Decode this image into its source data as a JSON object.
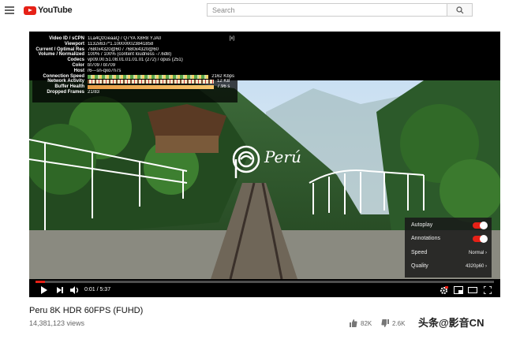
{
  "header": {
    "logo_text": "YouTube",
    "search_placeholder": "Search"
  },
  "stats": {
    "close_label": "[x]",
    "rows": [
      {
        "key": "Video ID / sCPN",
        "value": "1La4QzGeaaQ / Q7YA X8R8 YJA0"
      },
      {
        "key": "Viewport",
        "value": "1132x637*1.100000023841858"
      },
      {
        "key": "Current / Optimal Res",
        "value": "7680x4320@60 / 7680x4320@60"
      },
      {
        "key": "Volume / Normalized",
        "value": "100% / 100% (content loudness -7.6dB)"
      },
      {
        "key": "Codecs",
        "value": "vp09.00.51.08.01.01.01.01 (272) / opus (251)"
      },
      {
        "key": "Color",
        "value": "bt709 / bt709"
      },
      {
        "key": "Host",
        "value": "r6---sn-qxo7n7s"
      },
      {
        "key": "Connection Speed",
        "value": "2162 Kbps"
      },
      {
        "key": "Network Activity",
        "value": "12 KB"
      },
      {
        "key": "Buffer Health",
        "value": "7.96 s"
      },
      {
        "key": "Dropped Frames",
        "value": "21/83"
      }
    ]
  },
  "overlay": {
    "brand_text": "Perú"
  },
  "settings": {
    "autoplay_label": "Autoplay",
    "annotations_label": "Annotations",
    "speed_label": "Speed",
    "speed_value": "Normal",
    "quality_label": "Quality",
    "quality_value": "4320p60"
  },
  "player": {
    "time": "0:01 / 5:37",
    "progress_fraction": 0.003
  },
  "video": {
    "title": "Peru 8K HDR 60FPS (FUHD)",
    "views": "14,381,123 views",
    "likes": "82K",
    "dislikes": "2.6K"
  },
  "watermark": "头条@影音CN",
  "colors": {
    "accent": "#e62117"
  }
}
